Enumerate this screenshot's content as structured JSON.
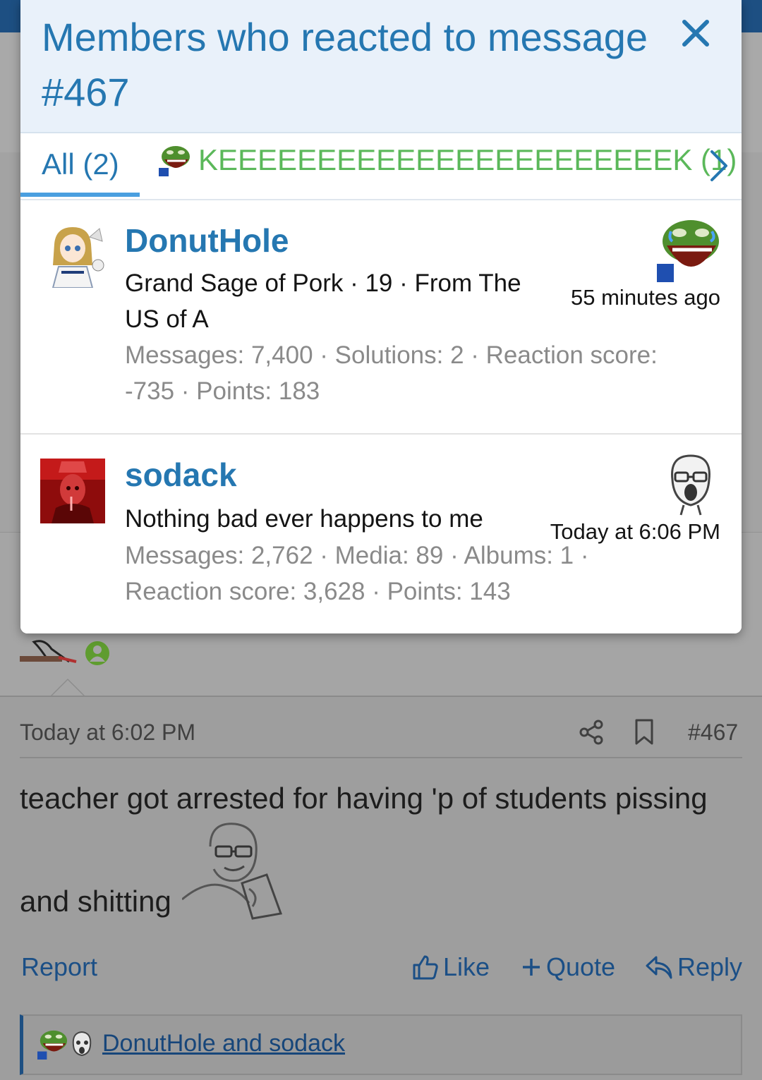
{
  "modal": {
    "title": "Members who reacted to message #467",
    "close_label": "×",
    "tabs": {
      "all_label": "All (2)",
      "keek_label": "KEEEEEEEEEEEEEEEEEEEEEEEK (1)"
    },
    "members": [
      {
        "name": "DonutHole",
        "title_line": "Grand Sage of Pork · 19 · From The US of A",
        "stats": "Messages: 7,400 · Solutions: 2 · Reaction score: -735 · Points: 183",
        "time": "55 minutes ago",
        "reaction_icon": "pepe-laugh-icon"
      },
      {
        "name": "sodack",
        "title_line": "Nothing bad ever happens to me",
        "stats": "Messages: 2,762 · Media: 89 · Albums: 1 · Reaction score: 3,628 · Points: 143",
        "time": "Today at 6:06 PM",
        "reaction_icon": "wojak-scream-icon"
      }
    ]
  },
  "background": {
    "post": {
      "time": "Today at 6:02 PM",
      "number": "#467",
      "line1": "teacher got arrested for having 'p of students pissing",
      "line2": "and shitting",
      "actions": {
        "report": "Report",
        "like": "Like",
        "quote": "Quote",
        "reply": "Reply"
      },
      "reactions_summary": "DonutHole and sodack"
    }
  },
  "colors": {
    "accent": "#2577b1",
    "keek_green": "#5bb85a",
    "header_bg": "#e9f1fa",
    "topbar": "#1d4f82"
  }
}
